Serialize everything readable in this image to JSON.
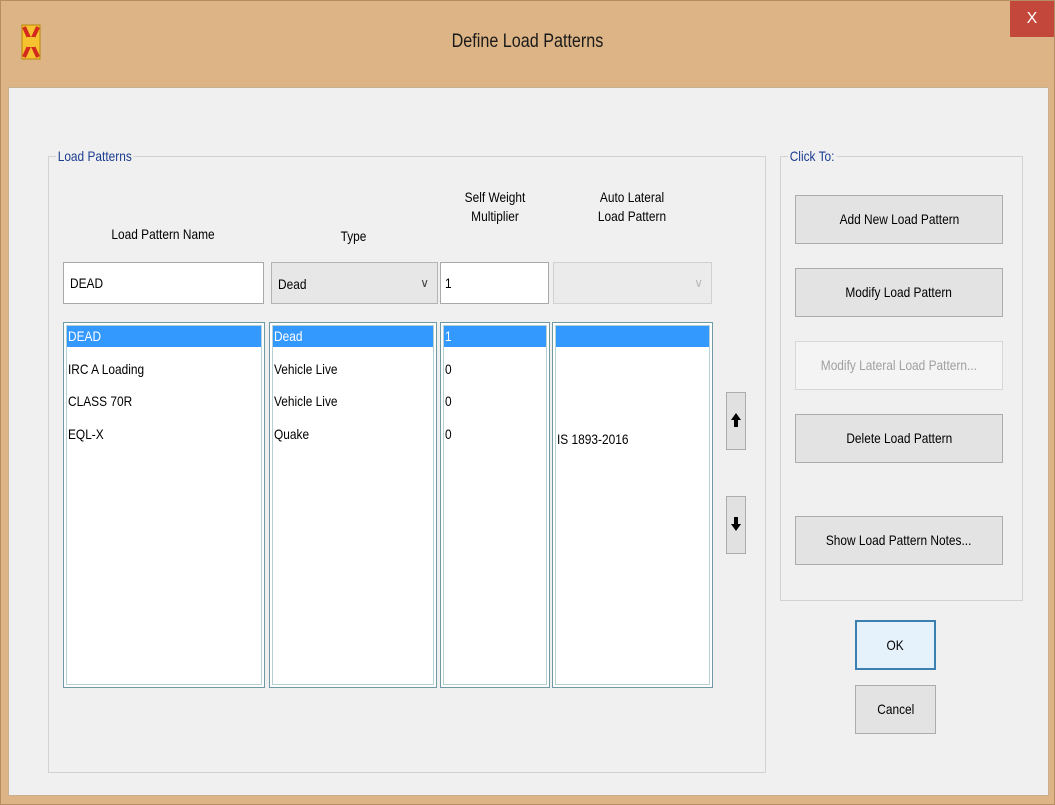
{
  "window": {
    "title": "Define Load Patterns",
    "close_label": "X"
  },
  "load_patterns": {
    "group_label": "Load Patterns",
    "headers": {
      "name": "Load Pattern Name",
      "type": "Type",
      "self_weight_line1": "Self Weight",
      "self_weight_line2": "Multiplier",
      "auto_lateral_line1": "Auto Lateral",
      "auto_lateral_line2": "Load Pattern"
    },
    "edit": {
      "name": "DEAD",
      "type": "Dead",
      "multiplier": "1",
      "auto_lateral": ""
    },
    "rows": [
      {
        "name": "DEAD",
        "type": "Dead",
        "multiplier": "1",
        "auto_lateral": ""
      },
      {
        "name": "IRC A Loading",
        "type": "Vehicle Live",
        "multiplier": "0",
        "auto_lateral": ""
      },
      {
        "name": "CLASS 70R",
        "type": "Vehicle Live",
        "multiplier": "0",
        "auto_lateral": ""
      },
      {
        "name": "EQL-X",
        "type": "Quake",
        "multiplier": "0",
        "auto_lateral": "IS 1893-2016"
      }
    ],
    "selected_index": 0
  },
  "click_to": {
    "group_label": "Click To:",
    "add": "Add New Load Pattern",
    "modify": "Modify Load Pattern",
    "modify_lateral": "Modify Lateral Load Pattern...",
    "delete": "Delete Load Pattern",
    "notes": "Show Load Pattern Notes..."
  },
  "footer": {
    "ok": "OK",
    "cancel": "Cancel"
  },
  "colors": {
    "title_bar": "#ddb485",
    "close_button": "#c4473c",
    "selection": "#3399ff",
    "group_label": "#1b3c8f"
  },
  "icons": {
    "app": "sap-app-icon",
    "move_up": "arrow-up-icon",
    "move_down": "arrow-down-icon",
    "dropdown": "chevron-down-icon"
  }
}
